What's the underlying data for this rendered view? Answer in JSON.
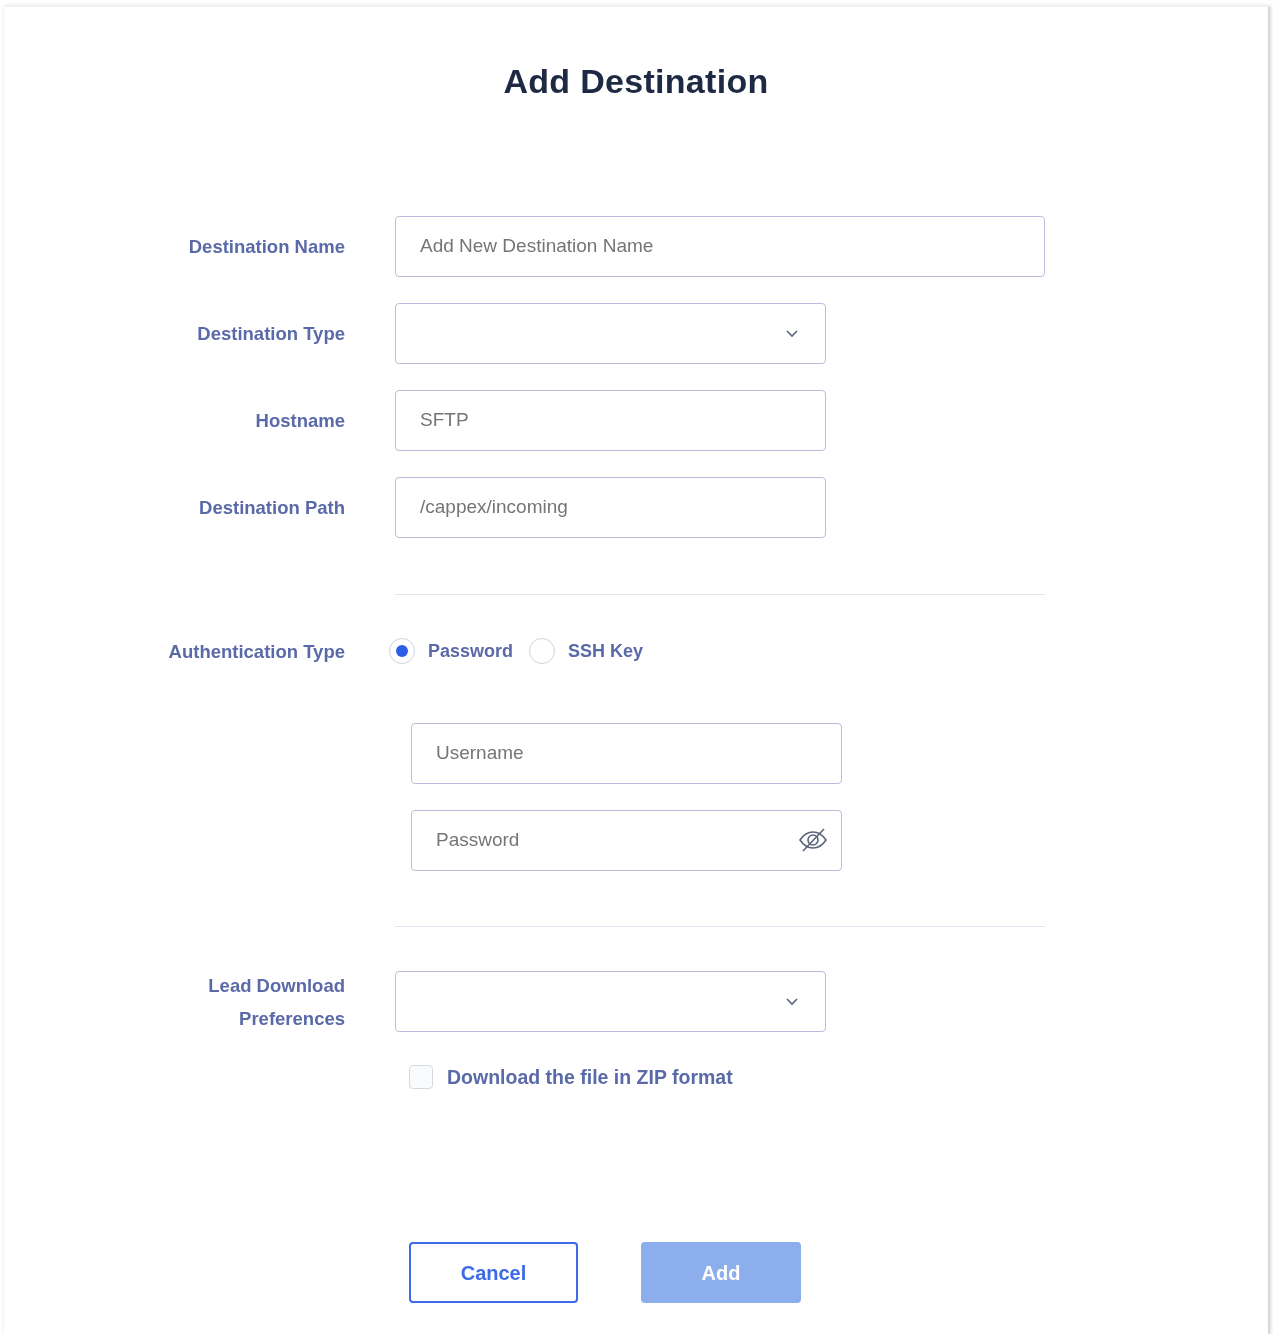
{
  "title": "Add Destination",
  "fields": [
    {
      "label": "Destination Name",
      "kind": "text",
      "placeholder": "Add New Destination Name"
    },
    {
      "label": "Destination Type",
      "kind": "select"
    },
    {
      "label": "Hostname",
      "kind": "text",
      "placeholder": "SFTP"
    },
    {
      "label": "Destination Path",
      "kind": "text",
      "placeholder": "/cappex/incoming"
    }
  ],
  "auth": {
    "label": "Authentication Type",
    "options": [
      {
        "label": "Password",
        "selected": true
      },
      {
        "label": "SSH Key",
        "selected": false
      }
    ],
    "fields": [
      {
        "kind": "text",
        "placeholder": "Username"
      },
      {
        "kind": "password",
        "placeholder": "Password"
      }
    ]
  },
  "preferences": {
    "label": "Lead Download Preferences",
    "kind": "select"
  },
  "zip_option": {
    "label": "Download the file in ZIP format",
    "checked": false
  },
  "buttons": [
    {
      "label": "Cancel",
      "kind": "outline",
      "disabled": false
    },
    {
      "label": "Add",
      "kind": "primary",
      "disabled": true
    }
  ]
}
